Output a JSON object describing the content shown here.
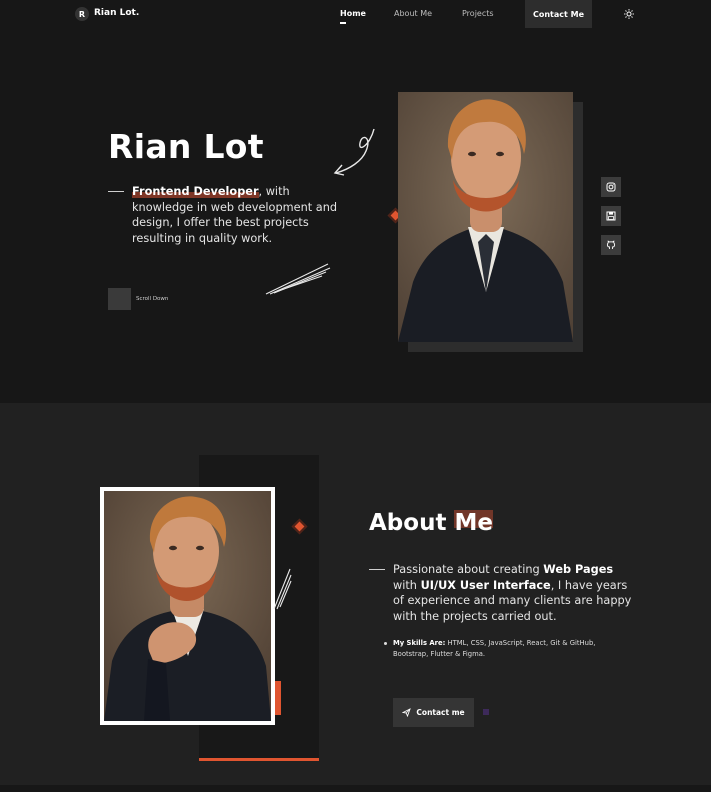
{
  "header": {
    "logo_letter": "R",
    "logo_text": "Rian Lot.",
    "nav": [
      "Home",
      "About Me",
      "Projects"
    ],
    "contact_label": "Contact Me",
    "theme_icon": "sun-icon"
  },
  "hero": {
    "title": "Rian Lot",
    "role": "Frontend Developer",
    "description": ", with knowledge in web development and design, I offer the best projects resulting in quality work.",
    "scroll_label": "Scroll Down",
    "social_icons": [
      "instagram-icon",
      "save-icon",
      "github-icon"
    ]
  },
  "about": {
    "title_main": "About ",
    "title_highlight": "Me",
    "desc_part1": "Passionate about creating ",
    "desc_bold1": "Web Pages",
    "desc_part2": " with ",
    "desc_bold2": "UI/UX User Interface",
    "desc_part3": ", I have years of experience and many clients are happy with the projects carried out.",
    "skills_label": "My Skills Are:",
    "skills_text": " HTML, CSS, JavaScript, React, Git & GitHub, Bootstrap, Flutter & Figma.",
    "contact_button": "Contact me"
  },
  "colors": {
    "accent": "#e05530",
    "background": "#171717",
    "section": "#212121"
  }
}
